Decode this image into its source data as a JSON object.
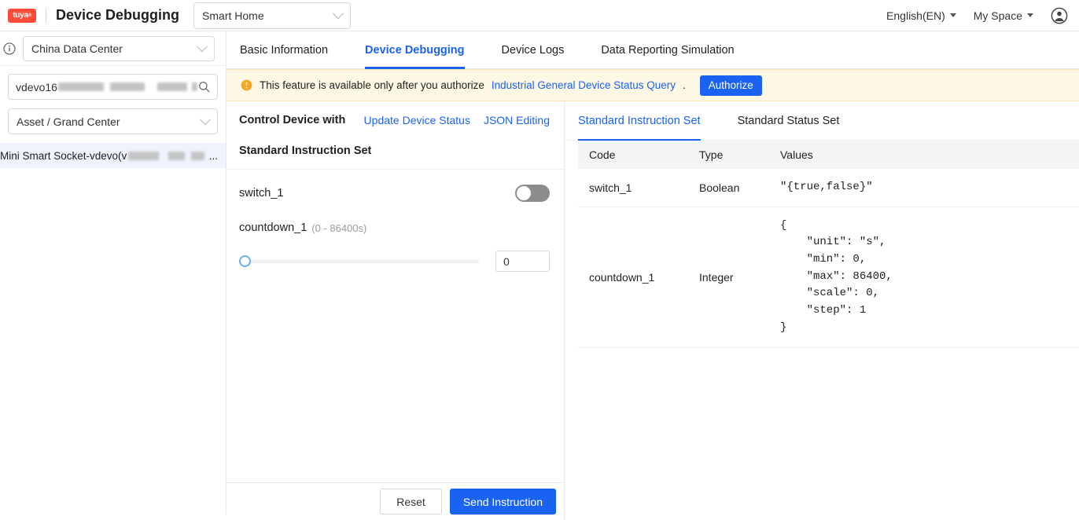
{
  "header": {
    "logo_text": "tuya",
    "logo_sup": "®",
    "app_title": "Device Debugging",
    "project_select": {
      "value": "Smart Home",
      "icon": "chevron-down-icon"
    },
    "language": "English(EN)",
    "space": "My Space",
    "avatar_icon": "user-avatar-icon"
  },
  "sidebar": {
    "info_icon": "info-circle-icon",
    "data_center": {
      "value": "China Data Center",
      "icon": "chevron-down-icon"
    },
    "search": {
      "value": "vdevo16",
      "placeholder": "",
      "redacted": true,
      "icon": "search-icon"
    },
    "asset": {
      "value": "Asset / Grand Center",
      "icon": "chevron-down-icon"
    },
    "devices": [
      {
        "label": "Mini Smart Socket-vdevo(v",
        "redacted": true,
        "ellipsis": "...",
        "selected": true
      }
    ]
  },
  "main": {
    "tabs": [
      {
        "label": "Basic Information",
        "active": false
      },
      {
        "label": "Device Debugging",
        "active": true
      },
      {
        "label": "Device Logs",
        "active": false
      },
      {
        "label": "Data Reporting Simulation",
        "active": false
      }
    ],
    "alert": {
      "icon": "warning-circle-icon",
      "text_before": "This feature is available only after you authorize",
      "link": "Industrial General Device Status Query",
      "text_after": ".",
      "button": "Authorize"
    },
    "control_panel": {
      "title": "Control Device with",
      "links": [
        {
          "label": "Update Device Status"
        },
        {
          "label": "JSON Editing"
        }
      ],
      "set_title": "Standard Instruction Set",
      "datapoints": [
        {
          "code": "switch_1",
          "control": "toggle",
          "value": false
        },
        {
          "code": "countdown_1",
          "hint": "(0 - 86400s)",
          "control": "slider",
          "value": "0",
          "min": 0,
          "max": 86400,
          "percent": 0
        }
      ],
      "footer": {
        "reset": "Reset",
        "send": "Send Instruction"
      }
    },
    "spec_panel": {
      "tabs": [
        {
          "label": "Standard Instruction Set",
          "active": true
        },
        {
          "label": "Standard Status Set",
          "active": false
        }
      ],
      "columns": [
        "Code",
        "Type",
        "Values"
      ],
      "rows": [
        {
          "code": "switch_1",
          "type": "Boolean",
          "values": "\"{true,false}\""
        },
        {
          "code": "countdown_1",
          "type": "Integer",
          "values": "{\n    \"unit\": \"s\",\n    \"min\": 0,\n    \"max\": 86400,\n    \"scale\": 0,\n    \"step\": 1\n}"
        }
      ]
    }
  },
  "colors": {
    "accent": "#1a62f2",
    "warning": "#faad14",
    "alert_bg": "#fdf8e3",
    "selected_row": "#eef3fd",
    "brand_red": "#ff4d3a"
  }
}
